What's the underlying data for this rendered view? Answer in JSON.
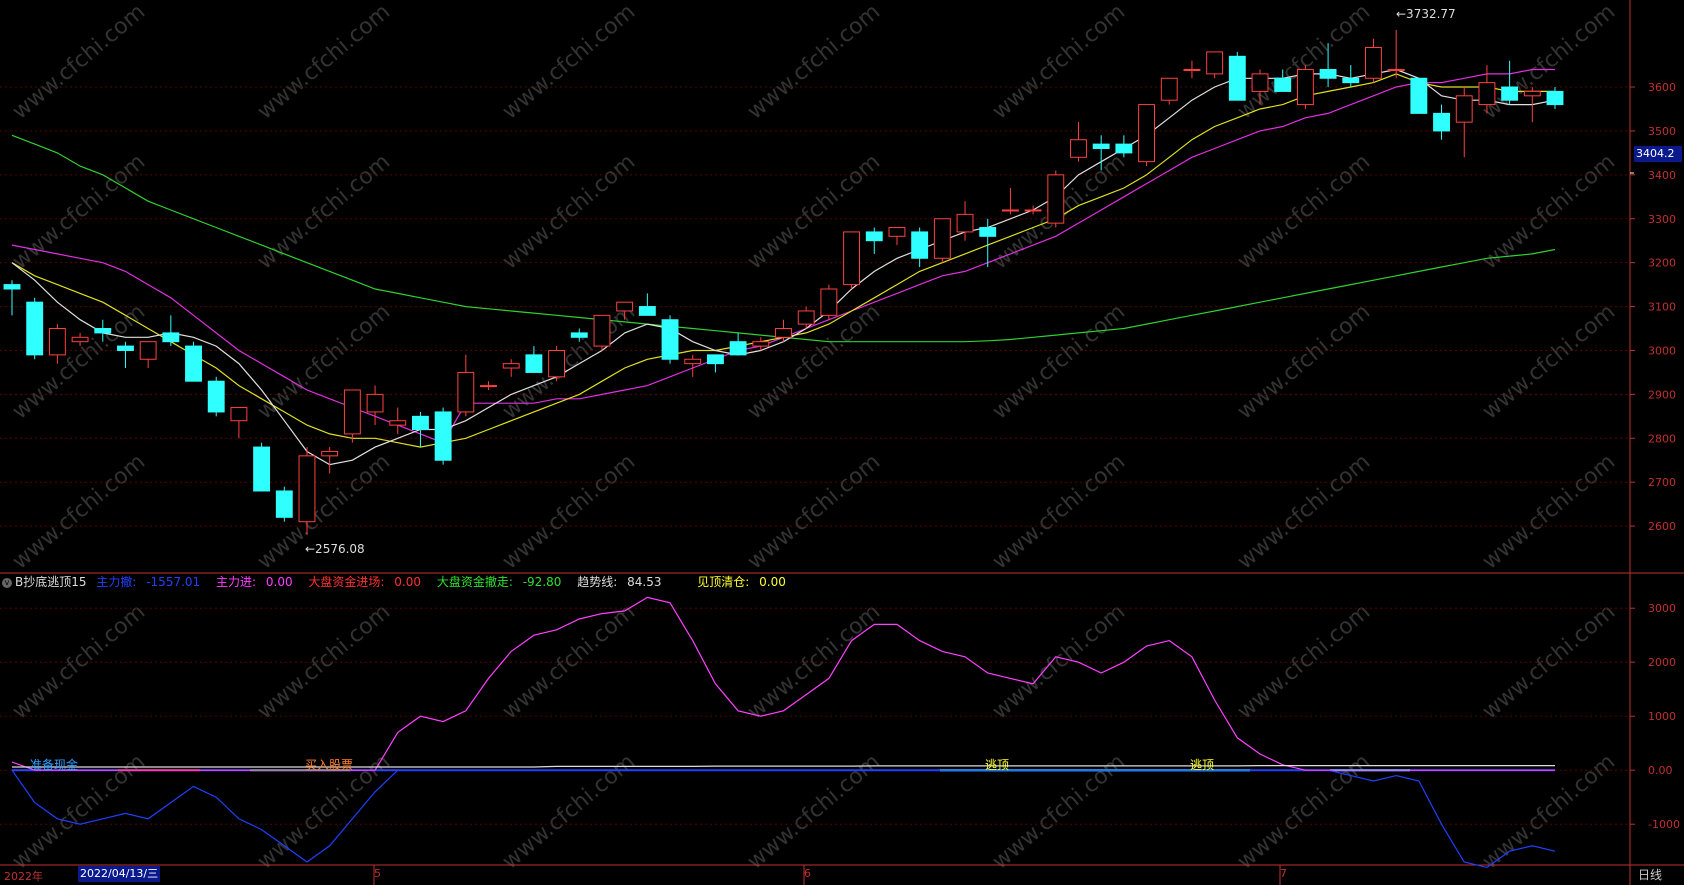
{
  "period": "日线",
  "current_price": "3404.2",
  "high_mark": "3732.77",
  "low_mark": "2576.08",
  "time_axis": {
    "year": "2022年",
    "cursor_date": "2022/04/13/三",
    "months": [
      "5",
      "6",
      "7"
    ]
  },
  "watermark": "www.cfchi.com",
  "indicator": {
    "name": "B抄底逃顶15",
    "items": [
      {
        "label": "主力撤:",
        "value": "-1557.01",
        "color": "#2040ff"
      },
      {
        "label": "主力进:",
        "value": "0.00",
        "color": "#ff40ff"
      },
      {
        "label": "大盘资金进场:",
        "value": "0.00",
        "color": "#ff3030"
      },
      {
        "label": "大盘资金撤走:",
        "value": "-92.80",
        "color": "#30e030"
      },
      {
        "label": "趋势线:",
        "value": "84.53",
        "color": "#dddddd"
      },
      {
        "label": "见顶清仓:",
        "value": "0.00",
        "color": "#ffff30"
      }
    ],
    "annotations": [
      {
        "text": "准备现金",
        "color": "#30a0ff"
      },
      {
        "text": "买入股票",
        "color": "#ff8030"
      },
      {
        "text": "逃顶",
        "color": "#ffff30"
      },
      {
        "text": "逃顶",
        "color": "#ffff30"
      }
    ]
  },
  "colors": {
    "up": "#ff4040",
    "down": "#30ffff",
    "grid": "#5a0000",
    "axis": "#c03030"
  },
  "chart_data": [
    {
      "type": "candlestick",
      "ylim": [
        2500,
        3780
      ],
      "y_ticks": [
        2600,
        2700,
        2800,
        2900,
        3000,
        3100,
        3200,
        3300,
        3400,
        3500,
        3600
      ],
      "candles": [
        [
          3150,
          3160,
          3080,
          3140
        ],
        [
          3110,
          3120,
          2980,
          2990
        ],
        [
          2990,
          3060,
          2970,
          3050
        ],
        [
          3020,
          3040,
          3010,
          3030
        ],
        [
          3050,
          3070,
          3020,
          3040
        ],
        [
          3010,
          3020,
          2960,
          3000
        ],
        [
          2980,
          3020,
          2960,
          3020
        ],
        [
          3040,
          3080,
          3010,
          3020
        ],
        [
          3010,
          3020,
          2930,
          2930
        ],
        [
          2930,
          2940,
          2850,
          2860
        ],
        [
          2840,
          2870,
          2800,
          2870
        ],
        [
          2780,
          2790,
          2680,
          2680
        ],
        [
          2680,
          2690,
          2610,
          2620
        ],
        [
          2610,
          2780,
          2580,
          2760
        ],
        [
          2760,
          2780,
          2720,
          2770
        ],
        [
          2810,
          2910,
          2790,
          2910
        ],
        [
          2860,
          2920,
          2830,
          2900
        ],
        [
          2830,
          2870,
          2810,
          2840
        ],
        [
          2850,
          2860,
          2780,
          2820
        ],
        [
          2860,
          2870,
          2740,
          2750
        ],
        [
          2860,
          2990,
          2850,
          2950
        ],
        [
          2920,
          2930,
          2910,
          2920
        ],
        [
          2960,
          2980,
          2940,
          2970
        ],
        [
          2990,
          3010,
          2950,
          2950
        ],
        [
          2940,
          3010,
          2930,
          3000
        ],
        [
          3040,
          3050,
          3020,
          3030
        ],
        [
          3010,
          3080,
          3000,
          3080
        ],
        [
          3090,
          3110,
          3070,
          3110
        ],
        [
          3100,
          3130,
          3090,
          3080
        ],
        [
          3070,
          3080,
          2970,
          2980
        ],
        [
          2970,
          2990,
          2940,
          2980
        ],
        [
          2990,
          2990,
          2950,
          2970
        ],
        [
          3020,
          3040,
          2990,
          2990
        ],
        [
          3010,
          3030,
          3000,
          3020
        ],
        [
          3030,
          3070,
          3020,
          3050
        ],
        [
          3060,
          3100,
          3050,
          3090
        ],
        [
          3080,
          3150,
          3070,
          3140
        ],
        [
          3150,
          3270,
          3140,
          3270
        ],
        [
          3270,
          3280,
          3220,
          3250
        ],
        [
          3260,
          3280,
          3240,
          3280
        ],
        [
          3270,
          3280,
          3190,
          3210
        ],
        [
          3210,
          3300,
          3200,
          3300
        ],
        [
          3270,
          3340,
          3250,
          3310
        ],
        [
          3280,
          3300,
          3190,
          3260
        ],
        [
          3320,
          3370,
          3310,
          3320
        ],
        [
          3320,
          3330,
          3310,
          3320
        ],
        [
          3290,
          3410,
          3280,
          3400
        ],
        [
          3440,
          3520,
          3430,
          3480
        ],
        [
          3470,
          3490,
          3410,
          3460
        ],
        [
          3470,
          3490,
          3440,
          3450
        ],
        [
          3430,
          3560,
          3420,
          3560
        ],
        [
          3570,
          3620,
          3560,
          3620
        ],
        [
          3640,
          3660,
          3620,
          3640
        ],
        [
          3630,
          3680,
          3620,
          3680
        ],
        [
          3670,
          3680,
          3570,
          3570
        ],
        [
          3590,
          3640,
          3560,
          3630
        ],
        [
          3620,
          3640,
          3590,
          3590
        ],
        [
          3560,
          3650,
          3550,
          3640
        ],
        [
          3640,
          3700,
          3600,
          3620
        ],
        [
          3620,
          3650,
          3600,
          3610
        ],
        [
          3620,
          3710,
          3610,
          3690
        ],
        [
          3640,
          3730,
          3620,
          3640
        ],
        [
          3620,
          3620,
          3540,
          3540
        ],
        [
          3540,
          3560,
          3480,
          3500
        ],
        [
          3520,
          3600,
          3440,
          3580
        ],
        [
          3560,
          3650,
          3540,
          3610
        ],
        [
          3600,
          3660,
          3560,
          3570
        ],
        [
          3580,
          3600,
          3520,
          3590
        ],
        [
          3590,
          3600,
          3550,
          3560
        ]
      ],
      "ma_white": [
        3200,
        3160,
        3110,
        3070,
        3040,
        3030,
        3030,
        3040,
        3030,
        3010,
        2970,
        2910,
        2840,
        2770,
        2740,
        2750,
        2780,
        2800,
        2820,
        2820,
        2840,
        2870,
        2900,
        2920,
        2940,
        2970,
        3000,
        3040,
        3060,
        3050,
        3020,
        3000,
        2990,
        3000,
        3020,
        3050,
        3090,
        3140,
        3180,
        3210,
        3230,
        3250,
        3270,
        3280,
        3300,
        3320,
        3350,
        3400,
        3430,
        3460,
        3490,
        3530,
        3570,
        3600,
        3620,
        3620,
        3620,
        3630,
        3630,
        3620,
        3630,
        3640,
        3620,
        3580,
        3570,
        3570,
        3560,
        3560,
        3570
      ],
      "ma_yellow": [
        3200,
        3170,
        3150,
        3130,
        3110,
        3080,
        3050,
        3020,
        2990,
        2960,
        2920,
        2890,
        2860,
        2830,
        2810,
        2800,
        2800,
        2790,
        2780,
        2790,
        2800,
        2820,
        2840,
        2860,
        2880,
        2900,
        2930,
        2960,
        2980,
        2990,
        3000,
        3000,
        3010,
        3020,
        3030,
        3040,
        3060,
        3090,
        3120,
        3150,
        3180,
        3200,
        3220,
        3240,
        3260,
        3280,
        3300,
        3330,
        3350,
        3370,
        3400,
        3440,
        3480,
        3510,
        3530,
        3550,
        3560,
        3580,
        3590,
        3600,
        3610,
        3630,
        3610,
        3600,
        3600,
        3600,
        3590,
        3590,
        3590
      ],
      "ma_magenta": [
        3240,
        3230,
        3220,
        3210,
        3200,
        3180,
        3150,
        3120,
        3080,
        3040,
        3000,
        2970,
        2940,
        2910,
        2890,
        2870,
        2850,
        2830,
        2810,
        2790,
        2880,
        2880,
        2880,
        2880,
        2890,
        2890,
        2900,
        2910,
        2920,
        2940,
        2960,
        2980,
        3000,
        3010,
        3030,
        3050,
        3070,
        3090,
        3110,
        3130,
        3150,
        3170,
        3180,
        3200,
        3220,
        3240,
        3260,
        3290,
        3320,
        3350,
        3380,
        3410,
        3440,
        3460,
        3480,
        3500,
        3510,
        3530,
        3540,
        3560,
        3580,
        3600,
        3610,
        3610,
        3620,
        3630,
        3630,
        3640,
        3640
      ],
      "ma_green": [
        3490,
        3470,
        3450,
        3420,
        3400,
        3370,
        3340,
        3320,
        3300,
        3280,
        3260,
        3240,
        3220,
        3200,
        3180,
        3160,
        3140,
        3130,
        3120,
        3110,
        3100,
        3095,
        3090,
        3085,
        3080,
        3075,
        3070,
        3065,
        3060,
        3055,
        3050,
        3045,
        3040,
        3035,
        3030,
        3025,
        3020,
        3020,
        3020,
        3020,
        3020,
        3020,
        3020,
        3022,
        3025,
        3030,
        3035,
        3040,
        3045,
        3050,
        3060,
        3070,
        3080,
        3090,
        3100,
        3110,
        3120,
        3130,
        3140,
        3150,
        3160,
        3170,
        3180,
        3190,
        3200,
        3210,
        3215,
        3220,
        3230
      ]
    },
    {
      "type": "line",
      "ylim": [
        -1700,
        3300
      ],
      "y_ticks": [
        3000,
        2000,
        1000,
        0,
        -1000
      ],
      "series": [
        {
          "name": "主力撤",
          "color": "#2040ff",
          "values": [
            0,
            -600,
            -900,
            -1000,
            -900,
            -800,
            -900,
            -600,
            -300,
            -500,
            -900,
            -1100,
            -1400,
            -1700,
            -1400,
            -900,
            -400,
            0,
            0,
            0,
            0,
            0,
            0,
            0,
            0,
            0,
            0,
            0,
            0,
            0,
            0,
            0,
            0,
            0,
            0,
            0,
            0,
            0,
            0,
            0,
            0,
            0,
            0,
            0,
            0,
            0,
            0,
            0,
            0,
            0,
            0,
            0,
            0,
            0,
            0,
            0,
            0,
            0,
            0,
            -100,
            -200,
            -100,
            -200,
            -1000,
            -1700,
            -1800,
            -1500,
            -1400,
            -1500
          ]
        },
        {
          "name": "主力进",
          "color": "#ff40ff",
          "values": [
            150,
            0,
            0,
            0,
            0,
            0,
            0,
            0,
            0,
            0,
            0,
            0,
            0,
            0,
            0,
            0,
            0,
            700,
            1000,
            900,
            1100,
            1700,
            2200,
            2500,
            2600,
            2800,
            2900,
            2950,
            3200,
            3100,
            2400,
            1600,
            1100,
            1000,
            1100,
            1400,
            1700,
            2400,
            2700,
            2700,
            2400,
            2200,
            2100,
            1800,
            1700,
            1600,
            2100,
            2000,
            1800,
            2000,
            2300,
            2400,
            2100,
            1300,
            600,
            300,
            100,
            0,
            0,
            0,
            0,
            0,
            0,
            0,
            0,
            0,
            0,
            0,
            0
          ]
        },
        {
          "name": "趋势线",
          "color": "#dddddd",
          "values": [
            60,
            60,
            60,
            60,
            60,
            60,
            60,
            60,
            60,
            60,
            60,
            60,
            60,
            60,
            60,
            60,
            60,
            60,
            60,
            60,
            60,
            60,
            60,
            60,
            70,
            70,
            70,
            70,
            70,
            70,
            70,
            75,
            75,
            75,
            75,
            75,
            75,
            75,
            80,
            80,
            80,
            80,
            80,
            80,
            80,
            80,
            80,
            80,
            80,
            80,
            80,
            80,
            80,
            80,
            80,
            85,
            85,
            85,
            85,
            85,
            85,
            85,
            85,
            85,
            85,
            85,
            85,
            85,
            85
          ]
        }
      ]
    }
  ]
}
